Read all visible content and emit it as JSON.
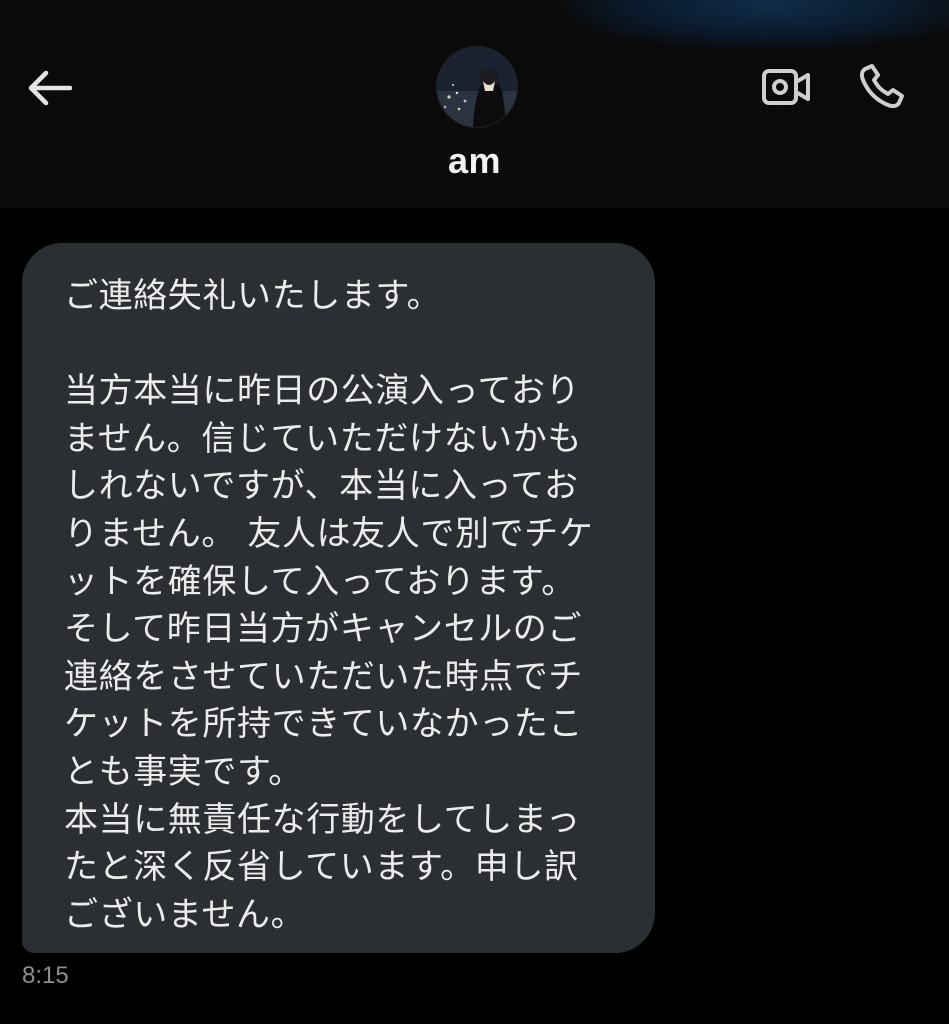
{
  "header": {
    "contact_name": "am",
    "back_icon": "arrow-left-icon",
    "video_icon": "video-camera-icon",
    "call_icon": "phone-icon"
  },
  "message": {
    "lines": [
      "ご連絡失礼いたします。",
      "",
      "当方本当に昨日の公演入っており",
      "ません。信じていただけないかも",
      "しれないですが、本当に入ってお",
      "りません。 友人は友人で別でチケ",
      "ットを確保して入っております。",
      "そして昨日当方がキャンセルのご",
      "連絡をさせていただいた時点でチ",
      "ケットを所持できていなかったこ",
      "とも事実です。",
      "本当に無責任な行動をしてしまっ",
      "たと深く反省しています。申し訳",
      "ございません。"
    ],
    "time": "8:15"
  },
  "colors": {
    "background": "#000000",
    "header_background": "#0a0a0a",
    "bubble": "#2b2e32",
    "text": "#ececec",
    "timestamp": "#8e8e93"
  }
}
